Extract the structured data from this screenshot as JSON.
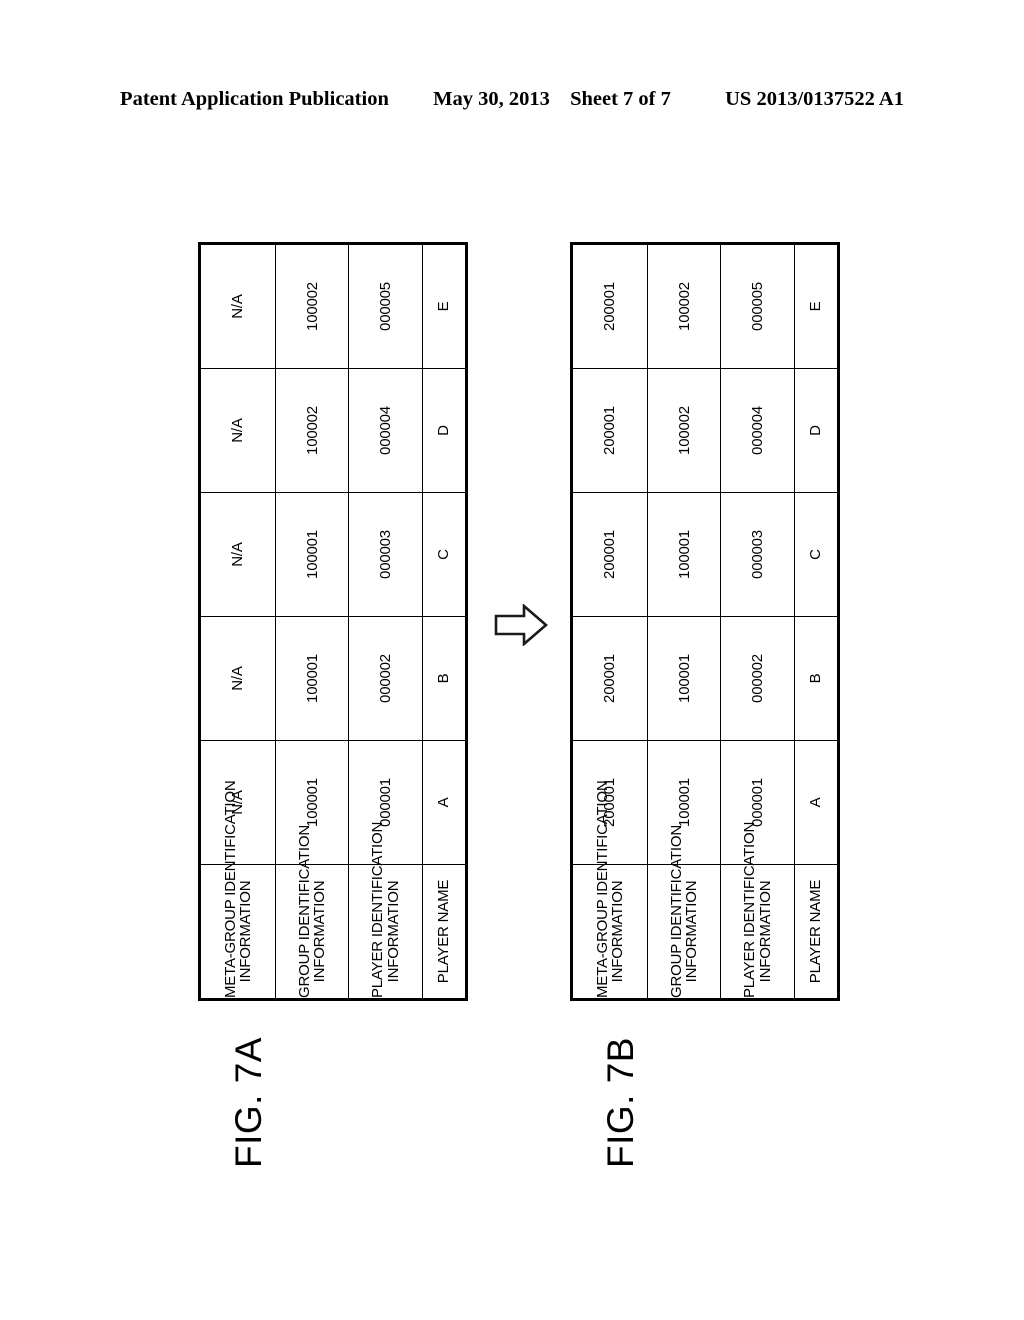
{
  "header": {
    "publication": "Patent Application Publication",
    "date": "May 30, 2013",
    "sheet": "Sheet 7 of 7",
    "docnumber": "US 2013/0137522 A1"
  },
  "columns": [
    {
      "line1": "PLAYER NAME",
      "line2": ""
    },
    {
      "line1": "PLAYER IDENTIFICATION",
      "line2": "INFORMATION"
    },
    {
      "line1": "GROUP IDENTIFICATION",
      "line2": "INFORMATION"
    },
    {
      "line1": "META-GROUP IDENTIFICATION",
      "line2": "INFORMATION"
    }
  ],
  "figures": [
    {
      "caption": "FIG. 7A",
      "rows": [
        {
          "player_name": "A",
          "player_id": "000001",
          "group_id": "100001",
          "meta_group_id": "N/A"
        },
        {
          "player_name": "B",
          "player_id": "000002",
          "group_id": "100001",
          "meta_group_id": "N/A"
        },
        {
          "player_name": "C",
          "player_id": "000003",
          "group_id": "100001",
          "meta_group_id": "N/A"
        },
        {
          "player_name": "D",
          "player_id": "000004",
          "group_id": "100002",
          "meta_group_id": "N/A"
        },
        {
          "player_name": "E",
          "player_id": "000005",
          "group_id": "100002",
          "meta_group_id": "N/A"
        }
      ]
    },
    {
      "caption": "FIG. 7B",
      "rows": [
        {
          "player_name": "A",
          "player_id": "000001",
          "group_id": "100001",
          "meta_group_id": "200001"
        },
        {
          "player_name": "B",
          "player_id": "000002",
          "group_id": "100001",
          "meta_group_id": "200001"
        },
        {
          "player_name": "C",
          "player_id": "000003",
          "group_id": "100001",
          "meta_group_id": "200001"
        },
        {
          "player_name": "D",
          "player_id": "000004",
          "group_id": "100002",
          "meta_group_id": "200001"
        },
        {
          "player_name": "E",
          "player_id": "000005",
          "group_id": "100002",
          "meta_group_id": "200001"
        }
      ]
    }
  ],
  "arrow": {
    "icon": "right-arrow-icon"
  },
  "colors": {
    "ink": "#000000",
    "paper": "#ffffff"
  }
}
